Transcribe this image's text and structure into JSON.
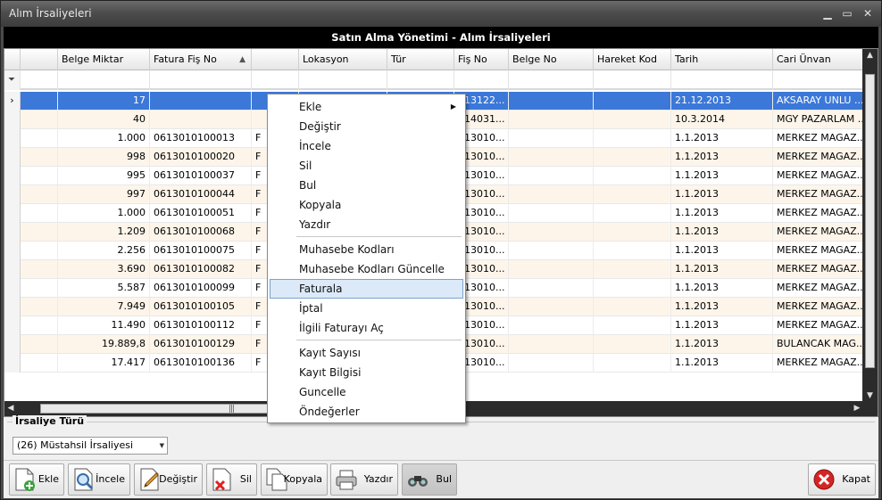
{
  "window": {
    "title": "Alım İrsaliyeleri",
    "minimize_label": "▁",
    "maximize_label": "▭",
    "close_label": "✕"
  },
  "grid": {
    "title": "Satın Alma Yönetimi - Alım İrsaliyeleri",
    "columns": [
      "",
      "Belge Miktar",
      "Fatura Fiş No",
      "",
      "Lokasyon",
      "Tür",
      "Fiş No",
      "Belge No",
      "Hareket Kod",
      "Tarih",
      "Cari Ünvan"
    ],
    "sort_indicator": "▲",
    "filter_icon": "filter-icon",
    "selected_row_indicator": "›",
    "rows": [
      {
        "miktar": "17",
        "fatura": "",
        "f": "",
        "lok": "",
        "tur": "",
        "fis": "613122...",
        "tarih": "21.12.2013",
        "cari": "AKSARAY UNLU ..."
      },
      {
        "miktar": "40",
        "fatura": "",
        "f": "",
        "lok": "",
        "tur": "",
        "fis": "614031...",
        "tarih": "10.3.2014",
        "cari": "MGY PAZARLAM ..."
      },
      {
        "miktar": "1.000",
        "fatura": "0613010100013",
        "f": "F",
        "lok": "",
        "tur": "",
        "fis": "613010...",
        "tarih": "1.1.2013",
        "cari": "MERKEZ MAGAZ..."
      },
      {
        "miktar": "998",
        "fatura": "0613010100020",
        "f": "F",
        "lok": "",
        "tur": "",
        "fis": "613010...",
        "tarih": "1.1.2013",
        "cari": "MERKEZ MAGAZ..."
      },
      {
        "miktar": "995",
        "fatura": "0613010100037",
        "f": "F",
        "lok": "",
        "tur": "",
        "fis": "613010...",
        "tarih": "1.1.2013",
        "cari": "MERKEZ MAGAZ..."
      },
      {
        "miktar": "997",
        "fatura": "0613010100044",
        "f": "F",
        "lok": "",
        "tur": "",
        "fis": "613010...",
        "tarih": "1.1.2013",
        "cari": "MERKEZ MAGAZ..."
      },
      {
        "miktar": "1.000",
        "fatura": "0613010100051",
        "f": "F",
        "lok": "",
        "tur": "",
        "fis": "613010...",
        "tarih": "1.1.2013",
        "cari": "MERKEZ MAGAZ..."
      },
      {
        "miktar": "1.209",
        "fatura": "0613010100068",
        "f": "F",
        "lok": "",
        "tur": "",
        "fis": "613010...",
        "tarih": "1.1.2013",
        "cari": "MERKEZ MAGAZ..."
      },
      {
        "miktar": "2.256",
        "fatura": "0613010100075",
        "f": "F",
        "lok": "",
        "tur": "",
        "fis": "613010...",
        "tarih": "1.1.2013",
        "cari": "MERKEZ MAGAZ..."
      },
      {
        "miktar": "3.690",
        "fatura": "0613010100082",
        "f": "F",
        "lok": "",
        "tur": "",
        "fis": "613010...",
        "tarih": "1.1.2013",
        "cari": "MERKEZ MAGAZ..."
      },
      {
        "miktar": "5.587",
        "fatura": "0613010100099",
        "f": "F",
        "lok": "",
        "tur": "",
        "fis": "613010...",
        "tarih": "1.1.2013",
        "cari": "MERKEZ MAGAZ..."
      },
      {
        "miktar": "7.949",
        "fatura": "0613010100105",
        "f": "F",
        "lok": "",
        "tur": "",
        "fis": "613010...",
        "tarih": "1.1.2013",
        "cari": "MERKEZ MAGAZ..."
      },
      {
        "miktar": "11.490",
        "fatura": "0613010100112",
        "f": "F",
        "lok": "",
        "tur": "",
        "fis": "613010...",
        "tarih": "1.1.2013",
        "cari": "MERKEZ MAGAZ..."
      },
      {
        "miktar": "19.889,8",
        "fatura": "0613010100129",
        "f": "F",
        "lok": "",
        "tur": "",
        "fis": "613010...",
        "tarih": "1.1.2013",
        "cari": "BULANCAK MAG..."
      },
      {
        "miktar": "17.417",
        "fatura": "0613010100136",
        "f": "F",
        "lok": "",
        "tur": "",
        "fis": "613010...",
        "tarih": "1.1.2013",
        "cari": "MERKEZ MAGAZ..."
      }
    ]
  },
  "irsaliye": {
    "label": "İrsaliye Türü",
    "selected": "(26) Müstahsil İrsaliyesi",
    "dropdown_icon": "▼"
  },
  "toolbar": {
    "ekle": "Ekle",
    "incele": "İncele",
    "degistir": "Değiştir",
    "sil": "Sil",
    "kopyala": "Kopyala",
    "yazdir": "Yazdır",
    "bul": "Bul",
    "kapat": "Kapat"
  },
  "context_menu": {
    "items": [
      "Ekle",
      "Değiştir",
      "İncele",
      "Sil",
      "Bul",
      "Kopyala",
      "Yazdır",
      "Muhasebe Kodları",
      "Muhasebe Kodları Güncelle",
      "Faturala",
      "İptal",
      "İlgili Faturayı Aç",
      "Kayıt Sayısı",
      "Kayıt Bilgisi",
      "Guncelle",
      "Öndeğerler"
    ],
    "submenu_arrow": "▶",
    "highlighted": "Faturala"
  },
  "colors": {
    "selected_row": "#3b78d8",
    "alt_row": "#fdf5ea",
    "title_bar": "#000000"
  }
}
